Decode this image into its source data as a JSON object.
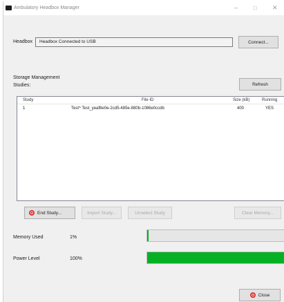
{
  "window": {
    "title": "Ambulatory Headbox Manager",
    "minimize_glyph": "–",
    "maximize_glyph": "□",
    "close_glyph": "✕"
  },
  "headbox": {
    "label": "Headbox",
    "status": "Headbox Connected to USB",
    "connect_label": "Connect..."
  },
  "storage": {
    "heading": "Storage Management",
    "studies_label": "Studies:",
    "refresh_label": "Refresh",
    "columns": [
      "Study",
      "File ID",
      "Size (kB)",
      "Running"
    ],
    "rows": [
      {
        "study": "1",
        "file_id": "Test^ Test_yeaf8e0e-2cd5-485e-880b-1086e0ccdb",
        "size": "400",
        "running": "YES"
      }
    ]
  },
  "buttons": {
    "end_study": "End Study...",
    "import_study": "Import Study...",
    "unselect_study": "Unselect Study",
    "clear_memory": "Clear Memory..."
  },
  "memory": {
    "label": "Memory Used",
    "value_text": "1%",
    "fraction": 0.01
  },
  "power": {
    "label": "Power Level",
    "value_text": "100%",
    "fraction": 1.0
  },
  "footer": {
    "close_label": "Close"
  },
  "colors": {
    "progress_green": "#06b025",
    "stop_red": "#e03030"
  }
}
